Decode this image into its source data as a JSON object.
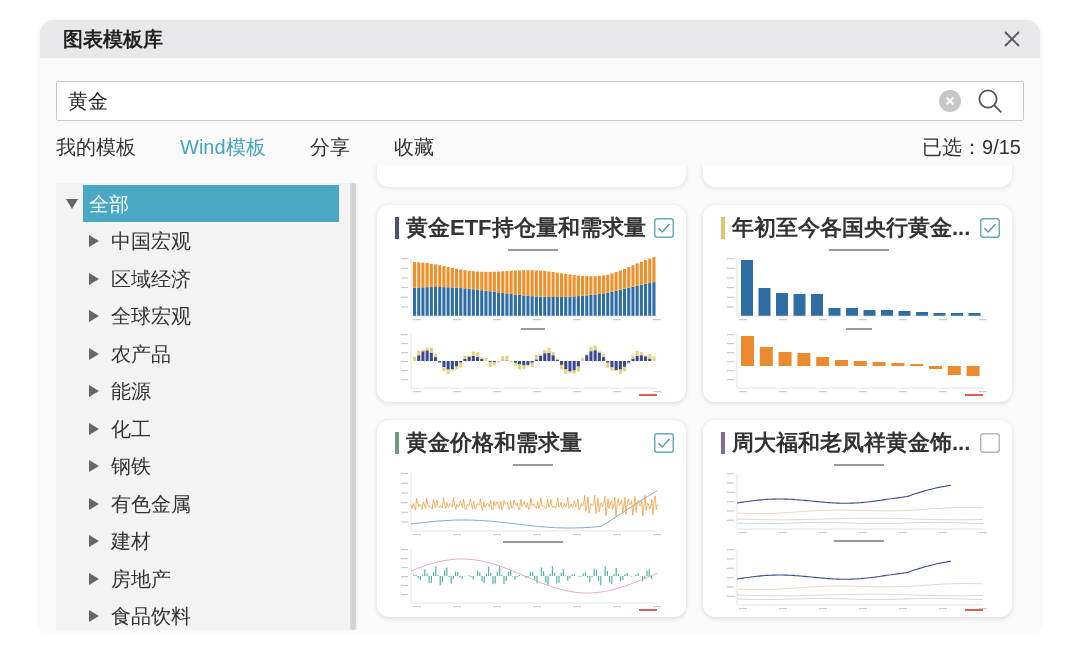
{
  "window": {
    "title": "图表模板库"
  },
  "search": {
    "value": "黄金"
  },
  "tabs": [
    {
      "label": "我的模板",
      "selected": false
    },
    {
      "label": "Wind模板",
      "selected": true
    },
    {
      "label": "分享",
      "selected": false
    },
    {
      "label": "收藏",
      "selected": false
    }
  ],
  "selection_count": "已选：9/15",
  "tree": {
    "items": [
      {
        "label": "全部",
        "selected": true,
        "expanded": true,
        "children": [
          {
            "label": "中国宏观",
            "selected": false,
            "expanded": false
          },
          {
            "label": "区域经济",
            "selected": false,
            "expanded": false
          },
          {
            "label": "全球宏观",
            "selected": false,
            "expanded": false
          },
          {
            "label": "农产品",
            "selected": false,
            "expanded": false
          },
          {
            "label": "能源",
            "selected": false,
            "expanded": false
          },
          {
            "label": "化工",
            "selected": false,
            "expanded": false
          },
          {
            "label": "钢铁",
            "selected": false,
            "expanded": false
          },
          {
            "label": "有色金属",
            "selected": false,
            "expanded": false
          },
          {
            "label": "建材",
            "selected": false,
            "expanded": false
          },
          {
            "label": "房地产",
            "selected": false,
            "expanded": false
          },
          {
            "label": "食品饮料",
            "selected": false,
            "expanded": false
          }
        ]
      }
    ]
  },
  "cards": [
    {
      "title": "黄金ETF持仓量和需求量",
      "color": "#4b5279",
      "checked": true,
      "kind": "stacked-bars"
    },
    {
      "title": "年初至今各国央行黄金...",
      "color": "#e3c46c",
      "checked": true,
      "kind": "ranked-bars"
    },
    {
      "title": "黄金价格和需求量",
      "color": "#6e9c7a",
      "checked": true,
      "kind": "price-lines"
    },
    {
      "title": "周大福和老凤祥黄金饰...",
      "color": "#7d6c9c",
      "checked": false,
      "kind": "trend-lines"
    }
  ]
}
